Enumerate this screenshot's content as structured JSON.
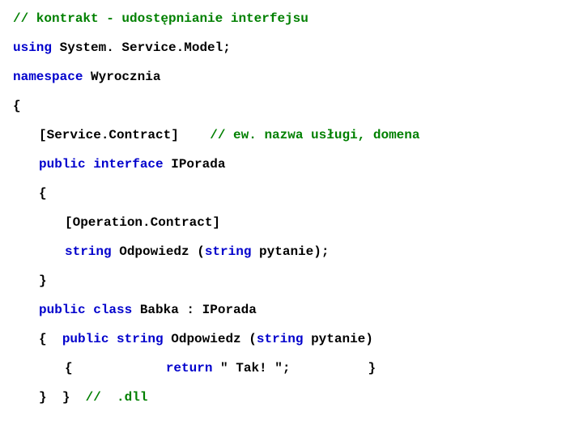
{
  "lines": {
    "l1_comment": "// kontrakt - udostępnianie interfejsu",
    "l2_using": "using",
    "l2_rest": " System. Service.Model;",
    "l3_ns": "namespace",
    "l3_rest": " Wyrocznia",
    "l4_brace": "{",
    "l5_attr": "[Service.Contract]",
    "l5_gap": "    ",
    "l5_comment": "// ew. nazwa usługi, domena",
    "l6_public": "public",
    "l6_interface": " interface",
    "l6_rest": " IPorada",
    "l7_brace": "{",
    "l8_attr": "[Operation.Contract]",
    "l9_string": "string",
    "l9_mid": " Odpowiedz (",
    "l9_string2": "string",
    "l9_end": " pytanie);",
    "l10_brace": "}",
    "l11_public": "public",
    "l11_class": " class",
    "l11_rest": " Babka : IPorada",
    "l12_brace": "{",
    "l12_gap": "  ",
    "l12_public": "public",
    "l12_string": " string",
    "l12_mid": " Odpowiedz (",
    "l12_string2": "string",
    "l12_end": " pytanie)",
    "l13_brace1": "{",
    "l13_gap1": "            ",
    "l13_return": "return",
    "l13_str": " \" Tak! \";",
    "l13_gap2": "          ",
    "l13_brace2": "}",
    "l14_b1": "}",
    "l14_g1": "  ",
    "l14_b2": "}",
    "l14_g2": "  ",
    "l14_comment": "//  .dll"
  }
}
